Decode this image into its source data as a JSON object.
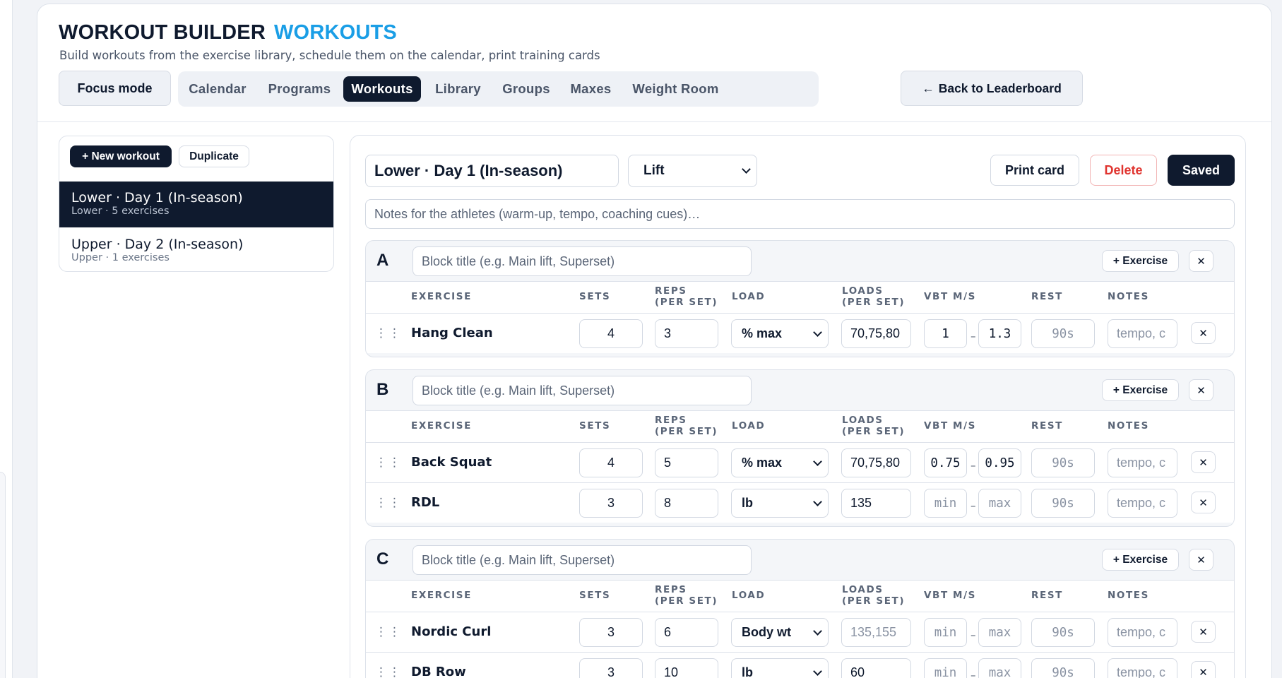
{
  "header": {
    "title": "WORKOUT BUILDER",
    "title_accent": "WORKOUTS",
    "subtitle": "Build workouts from the exercise library, schedule them on the calendar, print training cards",
    "focus_label": "Focus mode",
    "back_label": "Back to Leaderboard",
    "back_arrow": "←"
  },
  "tabs": [
    {
      "label": "Calendar",
      "active": false
    },
    {
      "label": "Programs",
      "active": false
    },
    {
      "label": "Workouts",
      "active": true
    },
    {
      "label": "Library",
      "active": false
    },
    {
      "label": "Groups",
      "active": false
    },
    {
      "label": "Maxes",
      "active": false
    },
    {
      "label": "Weight Room",
      "active": false
    }
  ],
  "list": {
    "new_label": "+ New workout",
    "duplicate_label": "Duplicate",
    "items": [
      {
        "name": "Lower · Day 1 (In-season)",
        "meta": "Lower · 5 exercises",
        "selected": true
      },
      {
        "name": "Upper · Day 2 (In-season)",
        "meta": "Upper · 1 exercises",
        "selected": false
      }
    ]
  },
  "editor": {
    "workout_name": "Lower · Day 1 (In-season)",
    "workout_type": "Lift",
    "print_label": "Print card",
    "delete_label": "Delete",
    "saved_label": "Saved",
    "notes_placeholder": "Notes for the athletes (warm-up, tempo, coaching cues)…",
    "block_title_placeholder": "Block title (e.g. Main lift, Superset)",
    "add_exercise_label": "+ Exercise",
    "remove_glyph": "✕",
    "drag_glyph": "⋮⋮",
    "range_dash": "–",
    "columns": {
      "exercise": "EXERCISE",
      "sets": "SETS",
      "reps_1": "REPS",
      "reps_2": "(PER SET)",
      "load": "LOAD",
      "loads_1": "LOADS",
      "loads_2": "(PER SET)",
      "vbt": "VBT M/S",
      "rest": "REST",
      "notes": "NOTES"
    },
    "blocks": [
      {
        "letter": "A",
        "rows": [
          {
            "exercise": "Hang Clean",
            "sets": "4",
            "reps": "3",
            "load": "% max",
            "loads": "70,75,80",
            "loads_placeholder": false,
            "vbt_min": "1",
            "vbt_max": "1.3",
            "vbt_placeholder": false,
            "rest": "90s",
            "notes": "tempo, c"
          }
        ]
      },
      {
        "letter": "B",
        "rows": [
          {
            "exercise": "Back Squat",
            "sets": "4",
            "reps": "5",
            "load": "% max",
            "loads": "70,75,80",
            "loads_placeholder": false,
            "vbt_min": "0.75",
            "vbt_max": "0.95",
            "vbt_placeholder": false,
            "rest": "90s",
            "notes": "tempo, c"
          },
          {
            "exercise": "RDL",
            "sets": "3",
            "reps": "8",
            "load": "lb",
            "loads": "135",
            "loads_placeholder": false,
            "vbt_min": "min",
            "vbt_max": "max",
            "vbt_placeholder": true,
            "rest": "90s",
            "notes": "tempo, c"
          }
        ]
      },
      {
        "letter": "C",
        "rows": [
          {
            "exercise": "Nordic Curl",
            "sets": "3",
            "reps": "6",
            "load": "Body wt",
            "loads": "135,155",
            "loads_placeholder": true,
            "vbt_min": "min",
            "vbt_max": "max",
            "vbt_placeholder": true,
            "rest": "90s",
            "notes": "tempo, c"
          },
          {
            "exercise": "DB Row",
            "sets": "3",
            "reps": "10",
            "load": "lb",
            "loads": "60",
            "loads_placeholder": false,
            "vbt_min": "min",
            "vbt_max": "max",
            "vbt_placeholder": true,
            "rest": "90s",
            "notes": "tempo, c"
          }
        ]
      }
    ]
  }
}
